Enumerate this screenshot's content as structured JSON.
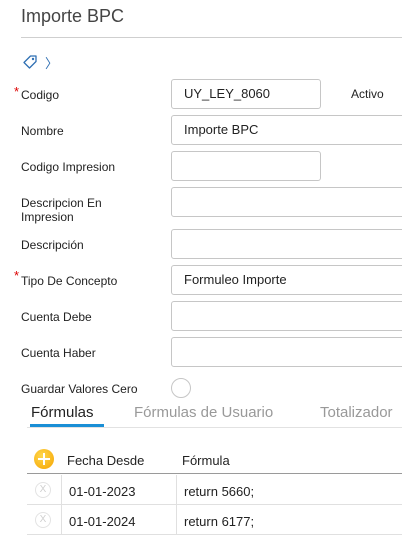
{
  "page": {
    "title": "Importe BPC"
  },
  "breadcrumb": {
    "separator": "〉"
  },
  "form": {
    "required_mark": "*",
    "codigo": {
      "label": "Codigo",
      "value": "UY_LEY_8060"
    },
    "activo": {
      "label": "Activo"
    },
    "nombre": {
      "label": "Nombre",
      "value": "Importe BPC"
    },
    "codigo_impresion": {
      "label": "Codigo Impresion",
      "value": ""
    },
    "descripcion_impresion": {
      "label_line1": "Descripcion En",
      "label_line2": "Impresion",
      "value": ""
    },
    "descripcion": {
      "label": "Descripción",
      "value": ""
    },
    "tipo_concepto": {
      "label": "Tipo De Concepto",
      "value": "Formuleo Importe"
    },
    "cuenta_debe": {
      "label": "Cuenta Debe",
      "value": ""
    },
    "cuenta_haber": {
      "label": "Cuenta Haber",
      "value": ""
    },
    "guardar_valores_cero": {
      "label": "Guardar Valores Cero",
      "checked": false
    }
  },
  "tabs": [
    {
      "label": "Fórmulas",
      "active": true
    },
    {
      "label": "Fórmulas de Usuario",
      "active": false
    },
    {
      "label": "Totalizador",
      "active": false
    }
  ],
  "formulas_grid": {
    "columns": [
      "Fecha Desde",
      "Fórmula"
    ],
    "delete_glyph": "X",
    "rows": [
      {
        "fecha_desde": "01-01-2023",
        "formula": "return 5660;"
      },
      {
        "fecha_desde": "01-01-2024",
        "formula": "return 6177;"
      }
    ]
  },
  "icons": {
    "tag": "tag-icon",
    "add": "add-circle-icon",
    "delete": "delete-icon"
  },
  "colors": {
    "accent": "#1a8fd6",
    "required": "#dd0000",
    "add_button": "#f5a300",
    "link": "#2f6fb3"
  }
}
